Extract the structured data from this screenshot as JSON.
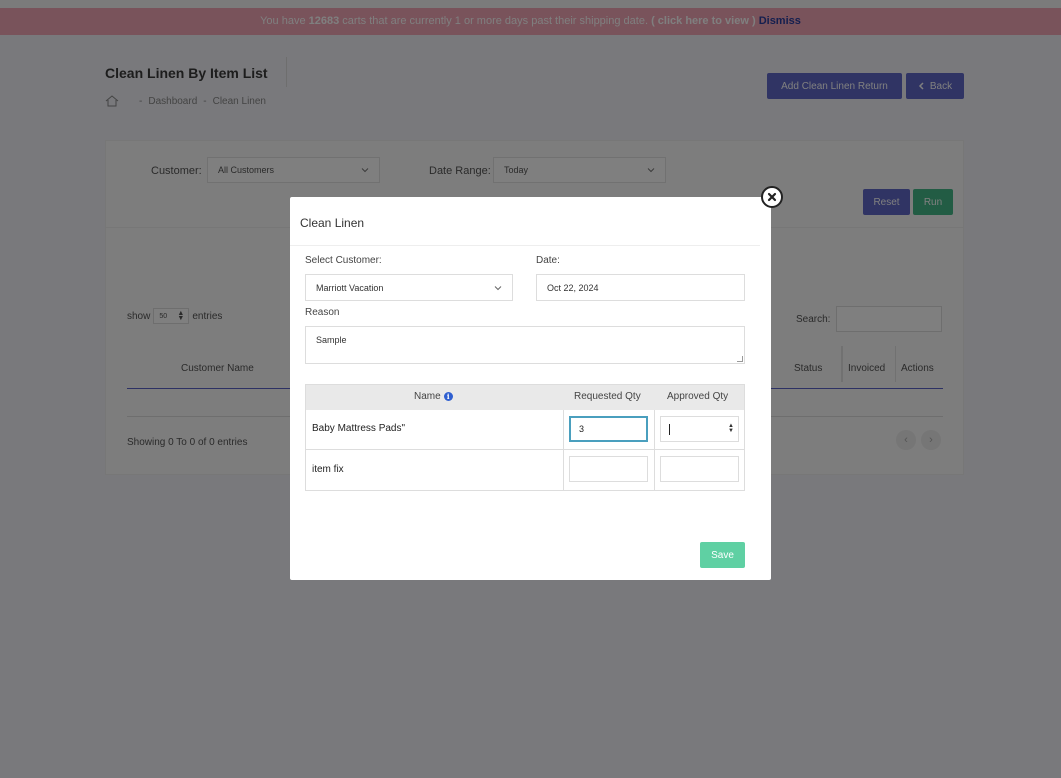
{
  "banner": {
    "prefix": "You have",
    "count": "12683",
    "suffix": "carts that are currently 1 or more days past their shipping date.",
    "view_link": "( click here to view )",
    "dismiss": "Dismiss"
  },
  "page": {
    "title": "Clean Linen By Item List",
    "breadcrumb": [
      "-",
      "Dashboard",
      "-",
      "Clean Linen"
    ],
    "add_button": "Add Clean Linen Return",
    "back_button": "Back"
  },
  "filters": {
    "customer_label": "Customer:",
    "customer_value": "All Customers",
    "date_label": "Date Range:",
    "date_value": "Today",
    "reset": "Reset",
    "run": "Run"
  },
  "list": {
    "show_label": "show",
    "show_value": "50",
    "entries_label": "entries",
    "search_label": "Search:",
    "columns": [
      "Customer Name",
      "Status",
      "Invoiced",
      "Actions"
    ],
    "showing": "Showing 0 To 0 of 0 entries"
  },
  "modal": {
    "title": "Clean Linen",
    "customer_label": "Select Customer:",
    "customer_value": "Marriott Vacation",
    "date_label": "Date:",
    "date_value": "Oct 22, 2024",
    "reason_label": "Reason",
    "reason_value": "Sample",
    "table_headers": [
      "Name",
      "Requested Qty",
      "Approved Qty"
    ],
    "rows": [
      {
        "name": "Baby Mattress Pads\"",
        "requested": "3",
        "approved": ""
      },
      {
        "name": "item fix",
        "requested": "",
        "approved": ""
      }
    ],
    "save": "Save"
  },
  "colors": {
    "banner_bg": "#f2a6b6",
    "primary": "#6068c8",
    "success": "#45b888",
    "save": "#5fd0a3"
  }
}
